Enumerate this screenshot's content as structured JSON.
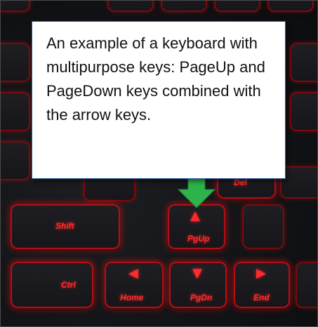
{
  "caption": "An example of a keyboard with multipurpose keys: PageUp and PageDown keys combined with the arrow keys.",
  "colors": {
    "key_glow": "#ff2a2a",
    "callout_border": "#2f5fa0",
    "pointer_arrow": "#2db34a"
  },
  "pointer": {
    "icon": "down-arrow-icon"
  },
  "keys": {
    "shift": "Shift",
    "ctrl": "Ctrl",
    "del": "Del",
    "pgup": "PgUp",
    "home": "Home",
    "pgdn": "PgDn",
    "end": "End"
  }
}
